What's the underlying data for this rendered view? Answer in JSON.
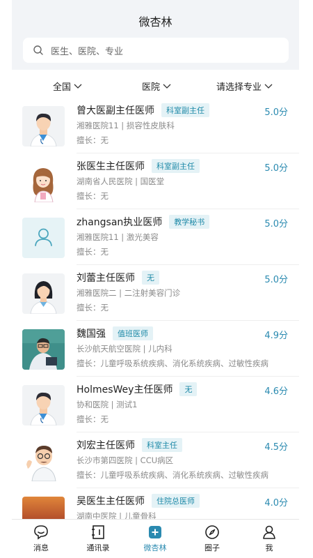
{
  "header": {
    "title": "微杏林"
  },
  "search": {
    "placeholder": "医生、医院、专业"
  },
  "filters": {
    "region": "全国",
    "hospital": "医院",
    "specialty": "请选择专业"
  },
  "doctors": [
    {
      "name": "曾大医副主任医师",
      "tag": "科室副主任",
      "score": "5.0分",
      "hospital": "湘雅医院11 | 损容性皮肤科",
      "skill": "擅长：无",
      "avatar": "male-doctor"
    },
    {
      "name": "张医生主任医师",
      "tag": "科室副主任",
      "score": "5.0分",
      "hospital": "湖南省人民医院 | 国医堂",
      "skill": "擅长：无",
      "avatar": "female-cartoon"
    },
    {
      "name": "zhangsan执业医师",
      "tag": "教学秘书",
      "score": "5.0分",
      "hospital": "湘雅医院11 | 激光美容",
      "skill": "擅长：无",
      "avatar": "user-placeholder"
    },
    {
      "name": "刘蕾主任医师",
      "tag": "无",
      "score": "5.0分",
      "hospital": "湘雅医院二 | 二注射美容门诊",
      "skill": "擅长：无",
      "avatar": "female-doctor"
    },
    {
      "name": "魏国强",
      "tag": "值班医师",
      "score": "4.9分",
      "hospital": "长沙航天航空医院 | 儿内科",
      "skill": "擅长：儿童呼吸系统疾病、消化系统疾病、过敏性疾病",
      "avatar": "photo-man"
    },
    {
      "name": "HolmesWey主任医师",
      "tag": "无",
      "score": "4.6分",
      "hospital": "协和医院 | 测试1",
      "skill": "擅长：无",
      "avatar": "male-doctor"
    },
    {
      "name": "刘宏主任医师",
      "tag": "科室主任",
      "score": "4.5分",
      "hospital": "长沙市第四医院 | CCU病区",
      "skill": "擅长：儿童呼吸系统疾病、消化系统疾病、过敏性疾病",
      "avatar": "cartoon-doctor"
    },
    {
      "name": "吴医生主任医师",
      "tag": "住院总医师",
      "score": "4.0分",
      "hospital": "湖南中医院 | 儿童骨科",
      "skill": "",
      "avatar": "sunset-photo"
    }
  ],
  "nav": [
    {
      "label": "消息",
      "icon": "message-icon"
    },
    {
      "label": "通讯录",
      "icon": "contacts-icon"
    },
    {
      "label": "微杏林",
      "icon": "plus-icon",
      "active": true
    },
    {
      "label": "圈子",
      "icon": "compass-icon"
    },
    {
      "label": "我",
      "icon": "person-icon"
    }
  ],
  "colors": {
    "accent": "#2a8ab0",
    "tag_bg": "#e4f2f6",
    "header_bg": "#f2f4f7"
  }
}
